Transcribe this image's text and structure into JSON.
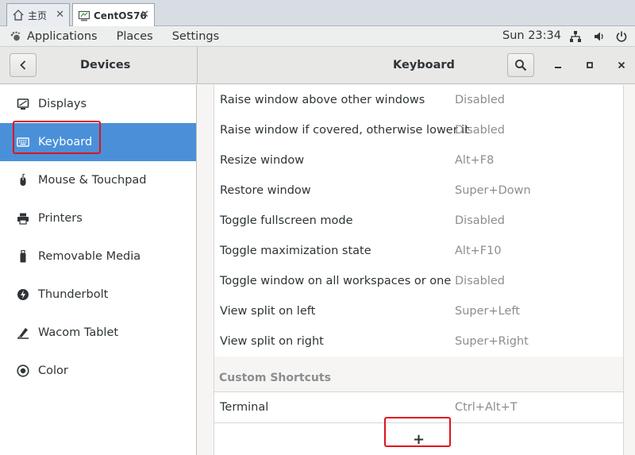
{
  "vm_tabs": [
    {
      "label": "主页"
    },
    {
      "label": "CentOS76"
    }
  ],
  "topbar": {
    "applications": "Applications",
    "places": "Places",
    "settings": "Settings",
    "clock": "Sun 23:34"
  },
  "header": {
    "sidebar_title": "Devices",
    "content_title": "Keyboard"
  },
  "sidebar": {
    "items": [
      {
        "label": "Displays",
        "icon": "display-icon"
      },
      {
        "label": "Keyboard",
        "icon": "keyboard-icon",
        "selected": true
      },
      {
        "label": "Mouse & Touchpad",
        "icon": "mouse-icon"
      },
      {
        "label": "Printers",
        "icon": "printer-icon"
      },
      {
        "label": "Removable Media",
        "icon": "usb-drive-icon"
      },
      {
        "label": "Thunderbolt",
        "icon": "thunderbolt-icon"
      },
      {
        "label": "Wacom Tablet",
        "icon": "tablet-icon"
      },
      {
        "label": "Color",
        "icon": "color-icon"
      }
    ]
  },
  "shortcuts": [
    {
      "name": "Raise window above other windows",
      "accel": "Disabled"
    },
    {
      "name": "Raise window if covered, otherwise lower it",
      "accel": "Disabled"
    },
    {
      "name": "Resize window",
      "accel": "Alt+F8"
    },
    {
      "name": "Restore window",
      "accel": "Super+Down"
    },
    {
      "name": "Toggle fullscreen mode",
      "accel": "Disabled"
    },
    {
      "name": "Toggle maximization state",
      "accel": "Alt+F10"
    },
    {
      "name": "Toggle window on all workspaces or one",
      "accel": "Disabled"
    },
    {
      "name": "View split on left",
      "accel": "Super+Left"
    },
    {
      "name": "View split on right",
      "accel": "Super+Right"
    }
  ],
  "custom_section": {
    "title": "Custom Shortcuts",
    "items": [
      {
        "name": "Terminal",
        "accel": "Ctrl+Alt+T"
      }
    ],
    "add_label": "+"
  },
  "colors": {
    "selection": "#4a90d9",
    "highlight_box": "#e0121c"
  }
}
